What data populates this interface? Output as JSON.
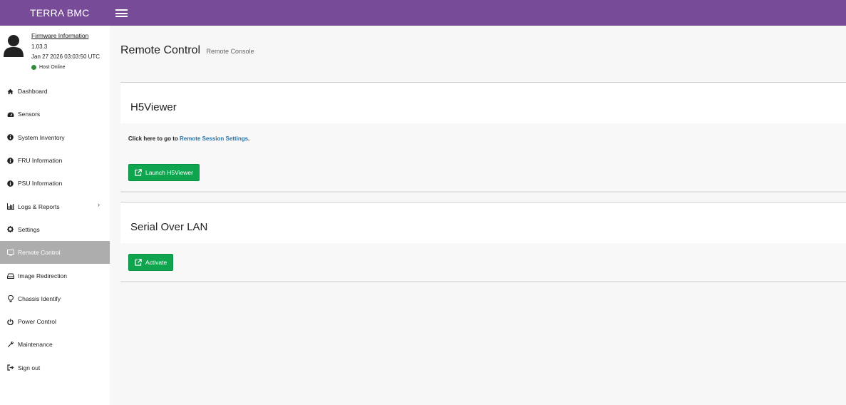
{
  "app": {
    "brand": "TERRA BMC"
  },
  "user_panel": {
    "firmware_title": "Firmware Information",
    "firmware_version": "1.03.3",
    "datetime": "Jan 27 2026 03:03:50 UTC",
    "host_status": "Host Online",
    "host_status_color": "#2f8d3a"
  },
  "sidebar": {
    "items": [
      {
        "label": "Dashboard",
        "icon": "home-icon"
      },
      {
        "label": "Sensors",
        "icon": "dashboard-gauge-icon"
      },
      {
        "label": "System Inventory",
        "icon": "info-circle-icon"
      },
      {
        "label": "FRU Information",
        "icon": "info-circle-icon"
      },
      {
        "label": "PSU Information",
        "icon": "info-circle-icon"
      },
      {
        "label": "Logs & Reports",
        "icon": "bar-chart-icon"
      },
      {
        "label": "Settings",
        "icon": "gear-icon"
      },
      {
        "label": "Remote Control",
        "icon": "monitor-icon",
        "active": true
      },
      {
        "label": "Image Redirection",
        "icon": "drive-icon"
      },
      {
        "label": "Chassis Identify",
        "icon": "lightbulb-icon"
      },
      {
        "label": "Power Control",
        "icon": "power-icon"
      },
      {
        "label": "Maintenance",
        "icon": "wrench-icon"
      },
      {
        "label": "Sign out",
        "icon": "sign-out-icon"
      }
    ]
  },
  "page": {
    "title": "Remote Control",
    "subtitle": "Remote Console"
  },
  "h5viewer": {
    "title": "H5Viewer",
    "info_prefix": "Click here to go to ",
    "info_link": "Remote Session Settings",
    "info_suffix": ".",
    "button_label": "Launch H5Viewer"
  },
  "sol": {
    "title": "Serial Over LAN",
    "button_label": "Activate"
  },
  "colors": {
    "topbar": "#784b99",
    "button": "#0fa54e",
    "active_menu": "#adadad",
    "link": "#2a75a8"
  }
}
